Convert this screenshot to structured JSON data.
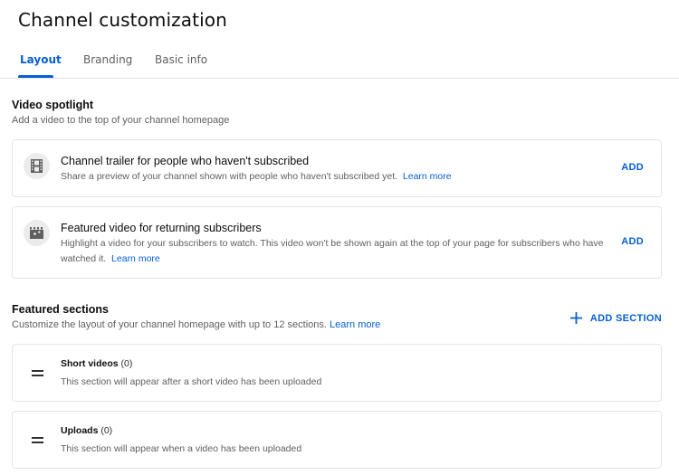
{
  "page": {
    "title": "Channel customization"
  },
  "tabs": [
    {
      "label": "Layout",
      "active": true
    },
    {
      "label": "Branding",
      "active": false
    },
    {
      "label": "Basic info",
      "active": false
    }
  ],
  "video_spotlight": {
    "title": "Video spotlight",
    "description": "Add a video to the top of your channel homepage",
    "cards": [
      {
        "icon": "film-icon",
        "title": "Channel trailer for people who haven't subscribed",
        "description": "Share a preview of your channel shown with people who haven't subscribed yet.",
        "link": "Learn more",
        "action": "ADD"
      },
      {
        "icon": "featured-video-icon",
        "title": "Featured video for returning subscribers",
        "description": "Highlight a video for your subscribers to watch. This video won't be shown again at the top of your page for subscribers who have watched it.",
        "link": "Learn more",
        "action": "ADD"
      }
    ]
  },
  "featured_sections": {
    "title": "Featured sections",
    "description": "Customize the layout of your channel homepage with up to 12 sections.",
    "link": "Learn more",
    "add_section_label": "ADD SECTION",
    "sections": [
      {
        "name": "Short videos",
        "count": "(0)",
        "description": "This section will appear after a short video has been uploaded"
      },
      {
        "name": "Uploads",
        "count": "(0)",
        "description": "This section will appear when a video has been uploaded"
      }
    ]
  },
  "colors": {
    "accent": "#065fd4",
    "text": "#0d0d0d",
    "secondary_text": "#606060",
    "border": "#e5e5e5"
  }
}
